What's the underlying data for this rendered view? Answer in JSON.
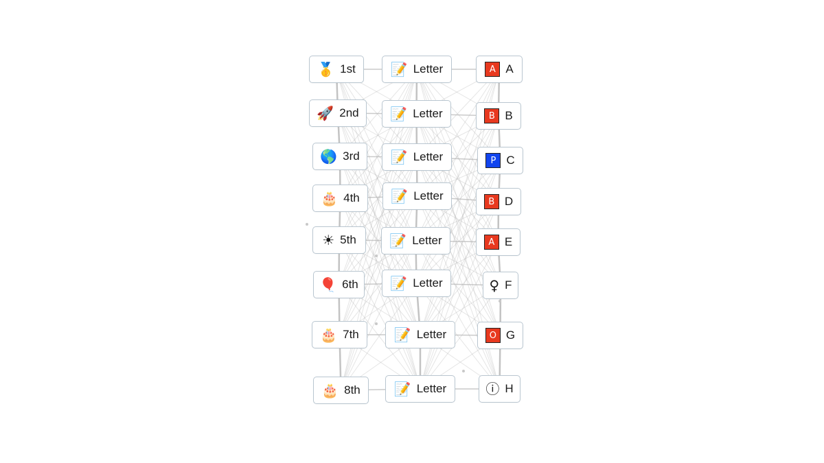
{
  "columns": {
    "ordinals": [
      {
        "icon": "sports-medal-icon",
        "glyph": "🥇",
        "label": "1st"
      },
      {
        "icon": "rocket-icon",
        "glyph": "🚀",
        "label": "2nd"
      },
      {
        "icon": "globe-icon",
        "glyph": "🌎",
        "label": "3rd"
      },
      {
        "icon": "birthday-cake-icon",
        "glyph": "🎂",
        "label": "4th"
      },
      {
        "icon": "sun-icon",
        "glyph": "☀",
        "label": "5th"
      },
      {
        "icon": "balloon-icon",
        "glyph": "🎈",
        "label": "6th"
      },
      {
        "icon": "birthday-cake-icon",
        "glyph": "🎂",
        "label": "7th"
      },
      {
        "icon": "birthday-cake-icon",
        "glyph": "🎂",
        "label": "8th"
      }
    ],
    "letters": [
      {
        "icon": "memo-icon",
        "glyph": "📝",
        "label": "Letter"
      },
      {
        "icon": "memo-icon",
        "glyph": "📝",
        "label": "Letter"
      },
      {
        "icon": "memo-icon",
        "glyph": "📝",
        "label": "Letter"
      },
      {
        "icon": "memo-icon",
        "glyph": "📝",
        "label": "Letter"
      },
      {
        "icon": "memo-icon",
        "glyph": "📝",
        "label": "Letter"
      },
      {
        "icon": "memo-icon",
        "glyph": "📝",
        "label": "Letter"
      },
      {
        "icon": "memo-icon",
        "glyph": "📝",
        "label": "Letter"
      },
      {
        "icon": "memo-icon",
        "glyph": "📝",
        "label": "Letter"
      }
    ],
    "alphabet": [
      {
        "icon": "a-button-icon",
        "badge": "A",
        "color": "#e8391f",
        "label": "A"
      },
      {
        "icon": "b-button-icon",
        "badge": "B",
        "color": "#e8391f",
        "label": "B"
      },
      {
        "icon": "p-button-icon",
        "badge": "P",
        "color": "#1144ee",
        "label": "C"
      },
      {
        "icon": "b-button-icon",
        "badge": "B",
        "color": "#e8391f",
        "label": "D"
      },
      {
        "icon": "a-button-icon",
        "badge": "A",
        "color": "#e8391f",
        "label": "E"
      },
      {
        "icon": "female-sign-icon",
        "glyph": "♀",
        "label": "F"
      },
      {
        "icon": "o-button-icon",
        "badge": "O",
        "color": "#e8391f",
        "label": "G"
      },
      {
        "icon": "information-icon",
        "glyph": "ⓘ",
        "label": "H"
      }
    ]
  },
  "colors": {
    "edge": "#b4b4b4",
    "border": "#b9c6d0"
  }
}
